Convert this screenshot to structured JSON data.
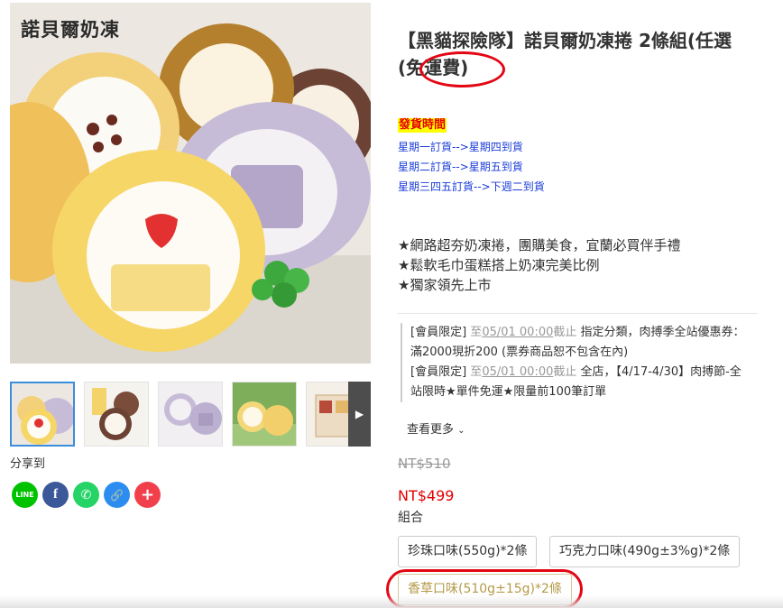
{
  "brand": {
    "logo_text": "諾貝爾奶凍"
  },
  "product": {
    "title": "【黑貓探險隊】諾貝爾奶凍捲 2條組(任選(免運費)",
    "shipping": {
      "heading": "發貨時間",
      "lines": [
        "星期一訂貨-->星期四到貨",
        "星期二訂貨-->星期五到貨",
        "星期三四五訂貨-->下週二到貨"
      ]
    },
    "features": [
      "★網路超夯奶凍捲，團購美食，宜蘭必買伴手禮",
      "★鬆軟毛巾蛋糕搭上奶凍完美比例",
      "★獨家領先上市"
    ],
    "promotions": [
      {
        "tag": "[會員限定]",
        "period_prefix": "至",
        "period_date": "05/01 00:00",
        "period_suffix": "截止",
        "text_line1": "指定分類，肉搏季全站優惠券：",
        "text_line2": "滿2000現折200 (票券商品恕不包含在內)"
      },
      {
        "tag": "[會員限定]",
        "period_prefix": "至",
        "period_date": "05/01 00:00",
        "period_suffix": "截止",
        "text_line1": "全店，【4/17-4/30】肉搏節-全",
        "text_line2": "站限時★單件免運★限量前100筆訂單"
      }
    ],
    "see_more": "查看更多",
    "original_price": "NT$510",
    "price": "NT$499",
    "option_group_label": "組合",
    "options": [
      {
        "label": "珍珠口味(550g)*2條",
        "selected": false
      },
      {
        "label": "巧克力口味(490g±3%g)*2條",
        "selected": false
      },
      {
        "label": "香草口味(510g±15g)*2條",
        "selected": true
      }
    ]
  },
  "gallery": {
    "thumbnail_count": 5,
    "next_icon": "chevron-right-icon"
  },
  "share": {
    "label": "分享到",
    "buttons": [
      {
        "name": "line",
        "text": "LINE",
        "color": "#00c300"
      },
      {
        "name": "facebook",
        "text": "f",
        "color": "#3b5998"
      },
      {
        "name": "whatsapp",
        "text": "✆",
        "color": "#25d366"
      },
      {
        "name": "copy-link",
        "text": "🔗",
        "color": "#2d8cf0"
      },
      {
        "name": "more",
        "text": "+",
        "color": "#f1404b"
      }
    ]
  },
  "colors": {
    "price_red": "#e30000",
    "highlight_yellow": "#ffff00",
    "shipping_blue": "#1a3cd8",
    "selected_option_gold": "#b49a47",
    "annotation_red": "#e30613"
  }
}
